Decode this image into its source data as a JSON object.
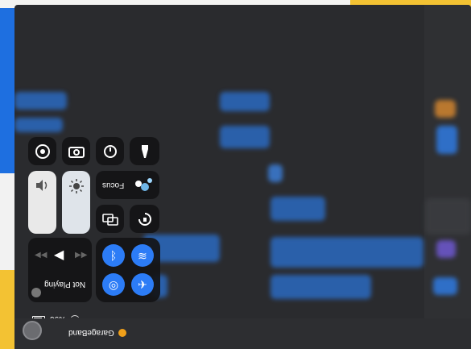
{
  "status_bar": {
    "battery": "%96"
  },
  "control_center": {
    "focus_label": "Focus",
    "now_playing": "Not Playing"
  },
  "dock": {
    "app_name": "GarageBand"
  },
  "colors": {
    "accent": "#2c7cf6",
    "screen": "#2a2b2e"
  },
  "icons": [
    "screen-record-icon",
    "camera-icon",
    "timer-icon",
    "flashlight-icon",
    "volume-icon",
    "brightness-icon",
    "focus-icon",
    "screen-mirror-icon",
    "rotation-lock-icon",
    "play-icon",
    "previous-icon",
    "next-icon",
    "airplay-icon",
    "bluetooth-icon",
    "wifi-icon",
    "airdrop-icon",
    "airplane-icon"
  ]
}
